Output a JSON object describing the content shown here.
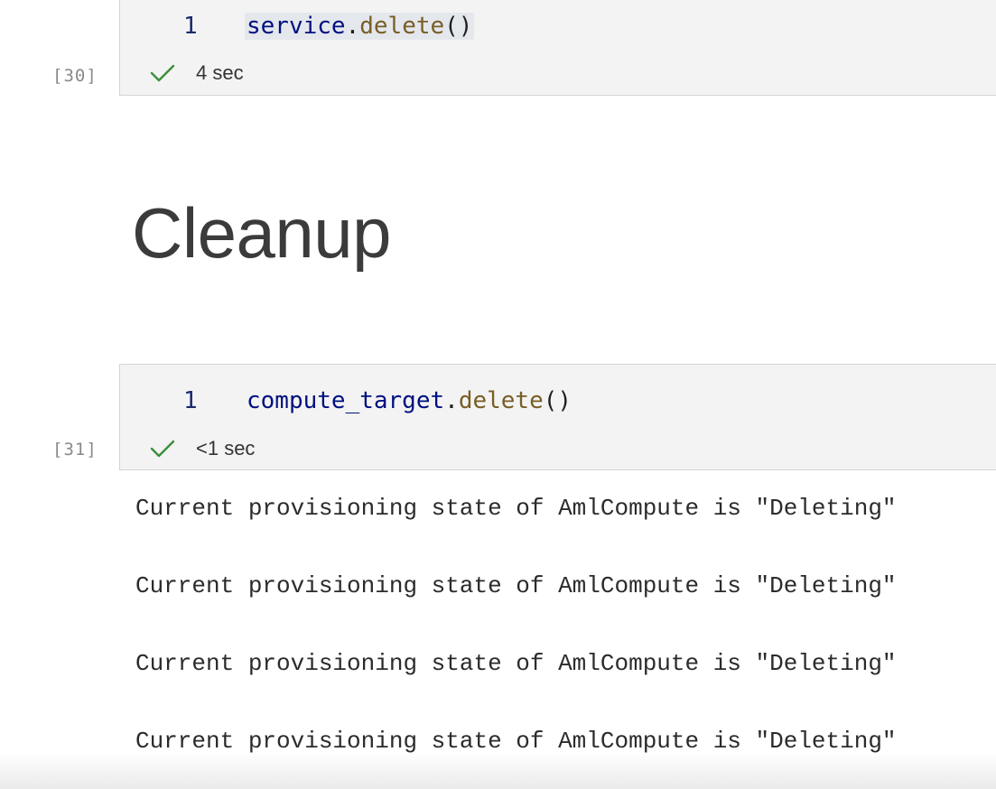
{
  "cells": [
    {
      "execution_count": "[30]",
      "line_number": "1",
      "code": {
        "object": "service",
        "dot": ".",
        "method": "delete",
        "parens": "()"
      },
      "status": {
        "icon": "check-icon",
        "duration": "4 sec"
      }
    },
    {
      "execution_count": "[31]",
      "line_number": "1",
      "code": {
        "object": "compute_target",
        "dot": ".",
        "method": "delete",
        "parens": "()"
      },
      "status": {
        "icon": "check-icon",
        "duration": "<1 sec"
      }
    }
  ],
  "markdown": {
    "heading": "Cleanup"
  },
  "output": {
    "lines": [
      "Current provisioning state of AmlCompute is \"Deleting\"",
      "Current provisioning state of AmlCompute is \"Deleting\"",
      "Current provisioning state of AmlCompute is \"Deleting\"",
      "Current provisioning state of AmlCompute is \"Deleting\""
    ]
  },
  "colors": {
    "success_check": "#3b8f3b",
    "cell_background": "#f3f3f3",
    "identifier": "#001080",
    "method": "#795e26"
  }
}
